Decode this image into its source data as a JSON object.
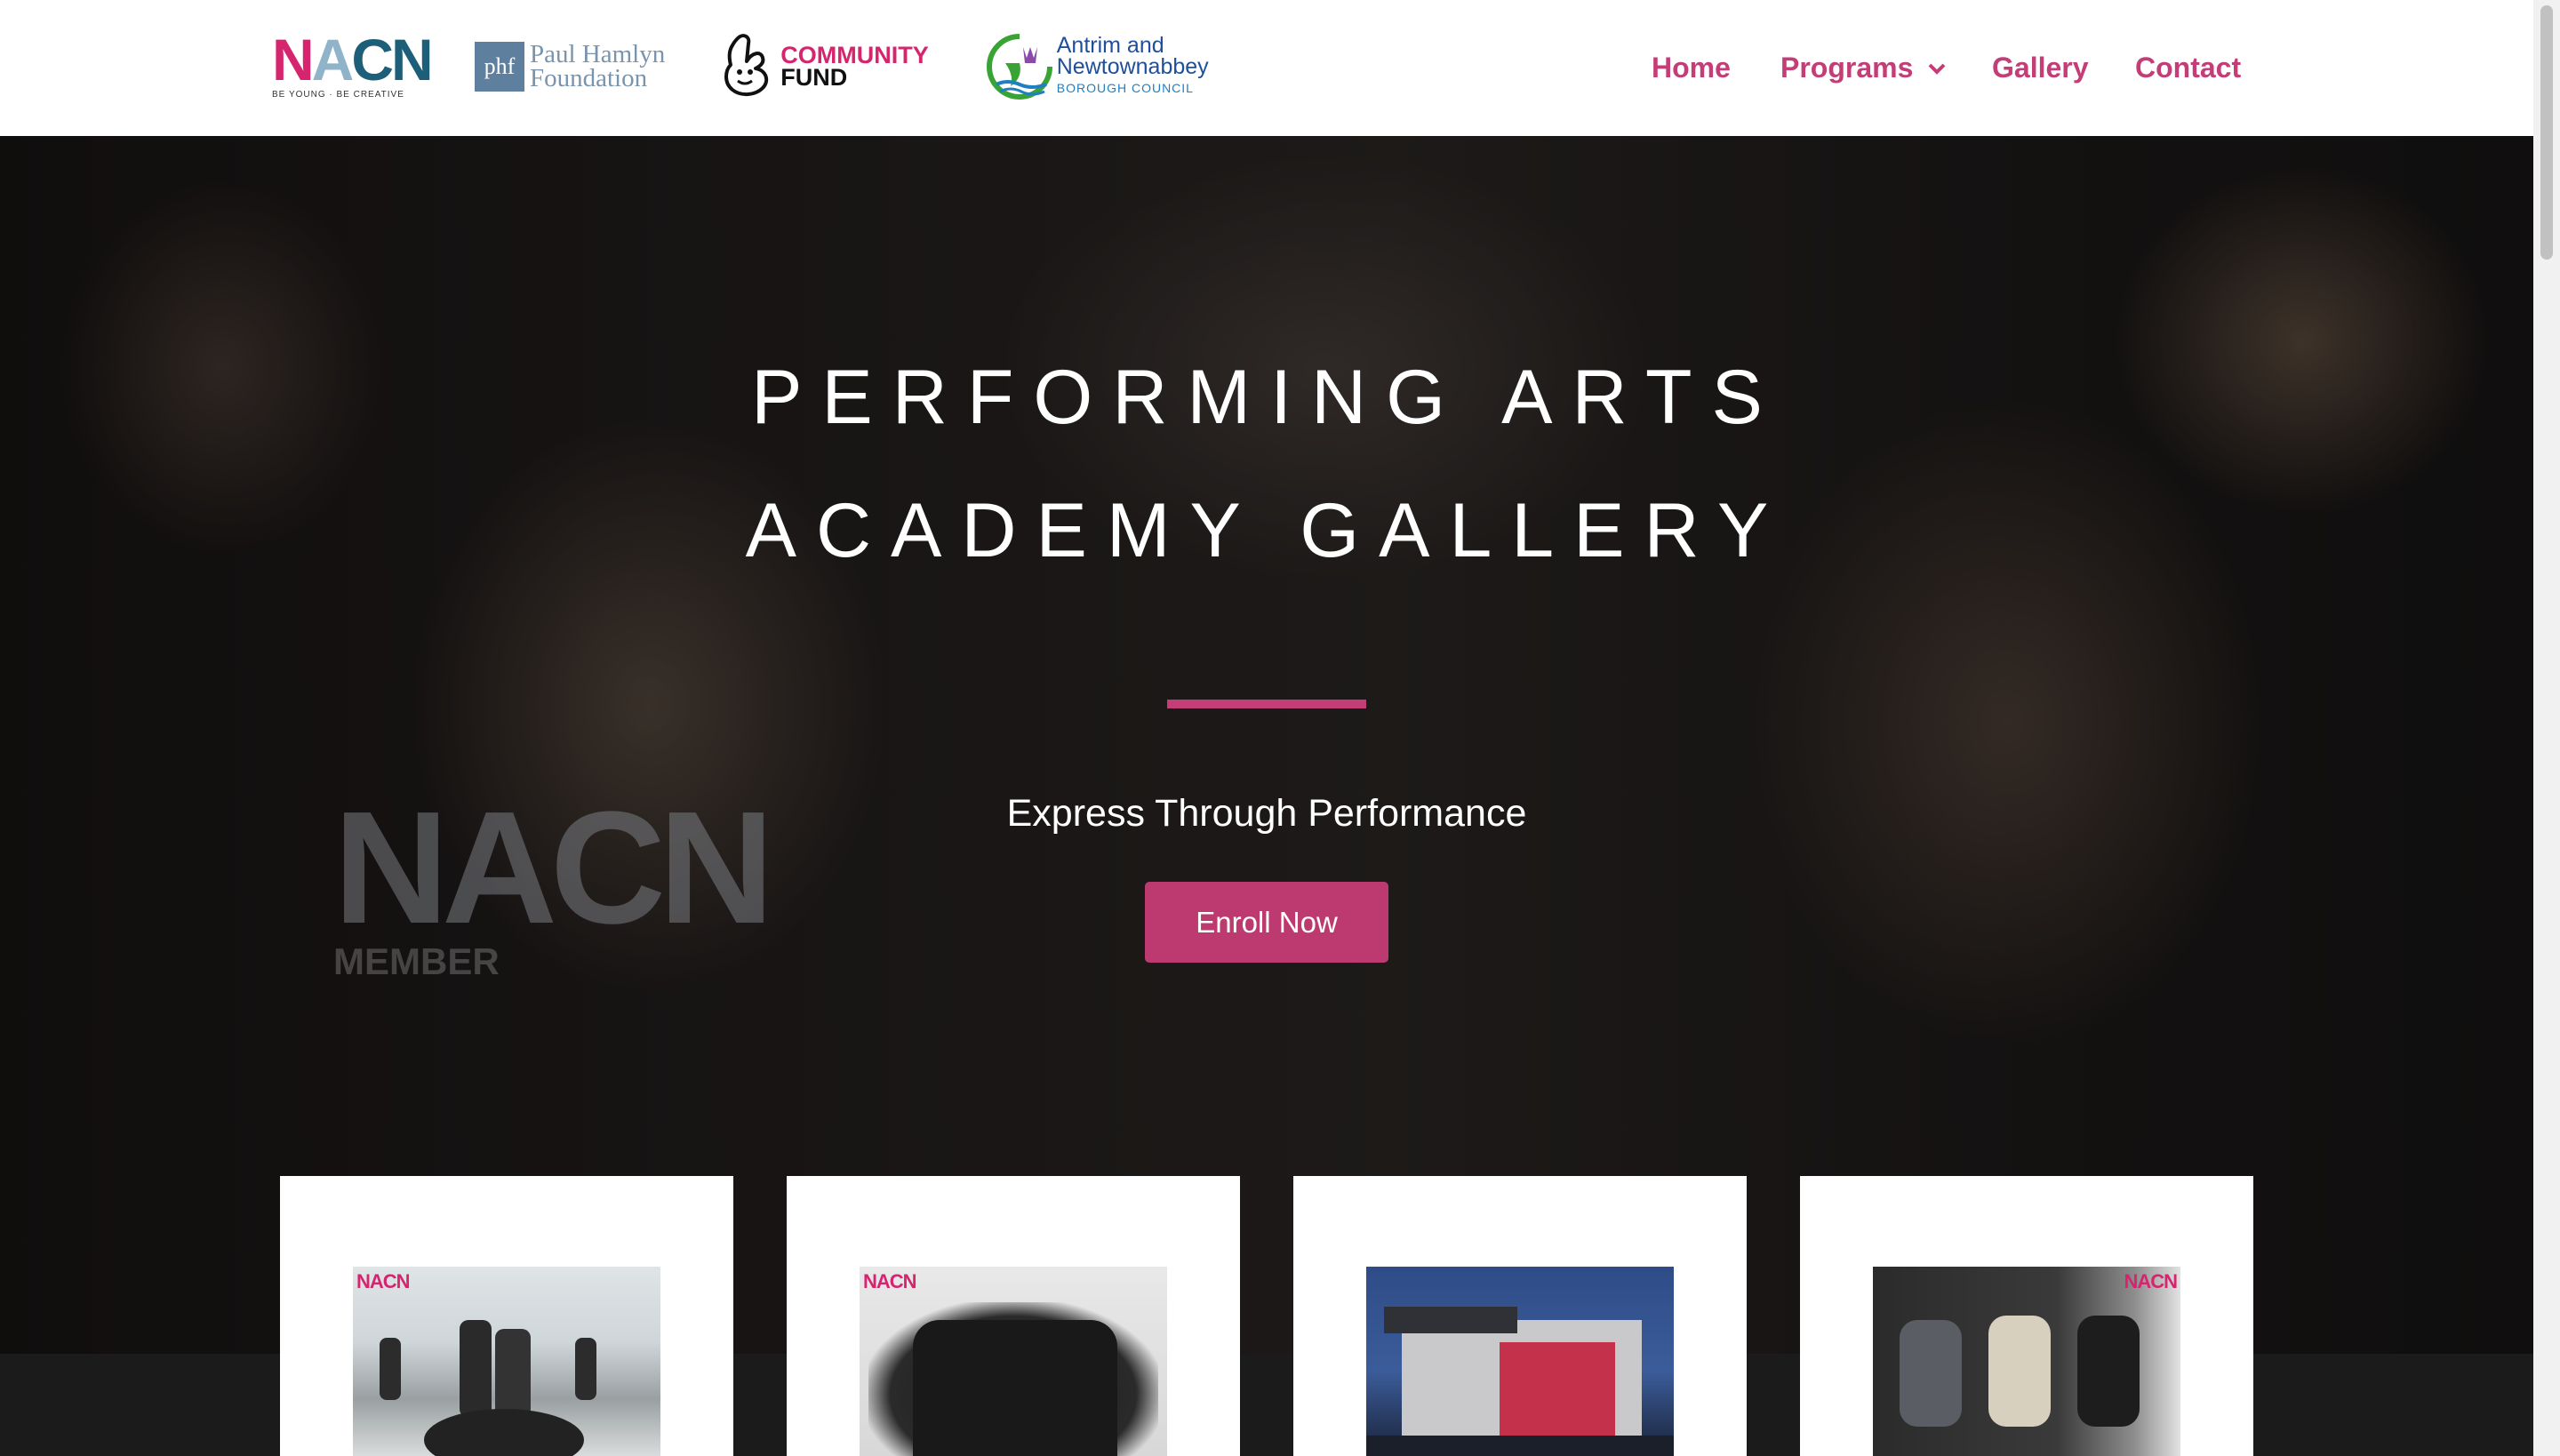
{
  "header": {
    "logos": {
      "nacn": {
        "letters": [
          "N",
          "A",
          "CN"
        ],
        "tagline": "BE YOUNG · BE CREATIVE"
      },
      "phf": {
        "mark": "phf",
        "line1": "Paul Hamlyn",
        "line2": "Foundation"
      },
      "community_fund": {
        "line1": "COMMUNITY",
        "line2": "FUND"
      },
      "council": {
        "line1": "Antrim and",
        "line2": "Newtownabbey",
        "line3": "BOROUGH COUNCIL"
      }
    },
    "nav": {
      "home": "Home",
      "programs": "Programs",
      "gallery": "Gallery",
      "contact": "Contact"
    }
  },
  "hero": {
    "title_line1": "PERFORMING ARTS",
    "title_line2": "ACADEMY GALLERY",
    "tagline": "Express Through Performance",
    "cta": "Enroll Now",
    "shirt_text": "NACN",
    "shirt_sub": "MEMBER"
  },
  "cards": [
    {
      "badge": "NACN"
    },
    {
      "badge": "NACN"
    },
    {
      "badge": ""
    },
    {
      "badge": "NACN"
    }
  ],
  "colors": {
    "accent": "#c33d77",
    "button": "#bd3a70",
    "header_bg": "#ffffff"
  }
}
